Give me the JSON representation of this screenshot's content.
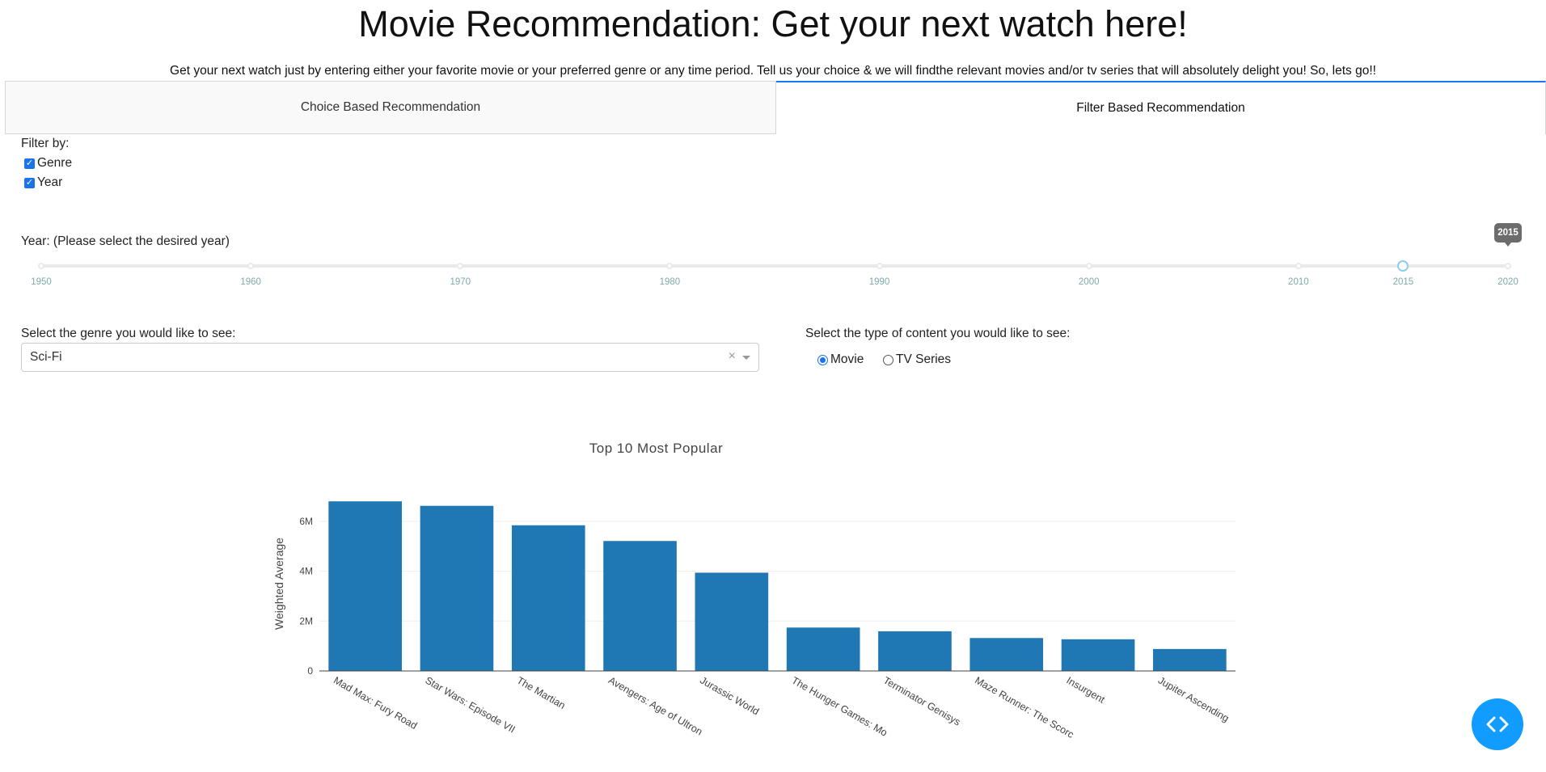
{
  "header": {
    "title": "Movie Recommendation: Get your next watch here!",
    "subtitle": "Get your next watch just by entering either your favorite movie or your preferred genre or any time period. Tell us your choice & we will findthe relevant movies and/or tv series that will absolutely delight you! So, lets go!!"
  },
  "tabs": [
    {
      "label": "Choice Based Recommendation",
      "selected": false
    },
    {
      "label": "Filter Based Recommendation",
      "selected": true
    }
  ],
  "filters": {
    "label": "Filter by:",
    "options": [
      {
        "label": "Genre",
        "checked": true
      },
      {
        "label": "Year",
        "checked": true
      }
    ]
  },
  "year_slider": {
    "label": "Year: (Please select the desired year)",
    "marks": [
      "1950",
      "1960",
      "1970",
      "1980",
      "1990",
      "2000",
      "2010",
      "2015",
      "2020"
    ],
    "min": 1950,
    "max": 2020,
    "value": 2015,
    "tooltip": "2015"
  },
  "genre": {
    "label": "Select the genre you would like to see:",
    "value": "Sci-Fi",
    "clear": "×"
  },
  "content_type": {
    "label": "Select the type of content you would like to see:",
    "options": [
      {
        "label": "Movie",
        "checked": true
      },
      {
        "label": "TV Series",
        "checked": false
      }
    ]
  },
  "colors": {
    "bar": "#1f77b4",
    "tab_accent": "#1975fa",
    "fab": "#119dff",
    "slider_mark": "#7fa9a9"
  },
  "chart_data": {
    "type": "bar",
    "title": "Top 10 Most Popular",
    "xlabel": "",
    "ylabel": "Weighted Average",
    "categories": [
      "Mad Max: Fury Road",
      "Star Wars: Episode VII",
      "The Martian",
      "Avengers: Age of Ultron",
      "Jurassic World",
      "The Hunger Games: Mo",
      "Terminator Genisys",
      "Maze Runner: The Scorc",
      "Insurgent",
      "Jupiter Ascending"
    ],
    "values": [
      6800000,
      6620000,
      5840000,
      5210000,
      3940000,
      1740000,
      1590000,
      1320000,
      1270000,
      880000
    ],
    "yticks": [
      0,
      2000000,
      4000000,
      6000000
    ],
    "ytick_labels": [
      "0",
      "2M",
      "4M",
      "6M"
    ],
    "ylim": [
      0,
      7000000
    ],
    "grid": true
  }
}
